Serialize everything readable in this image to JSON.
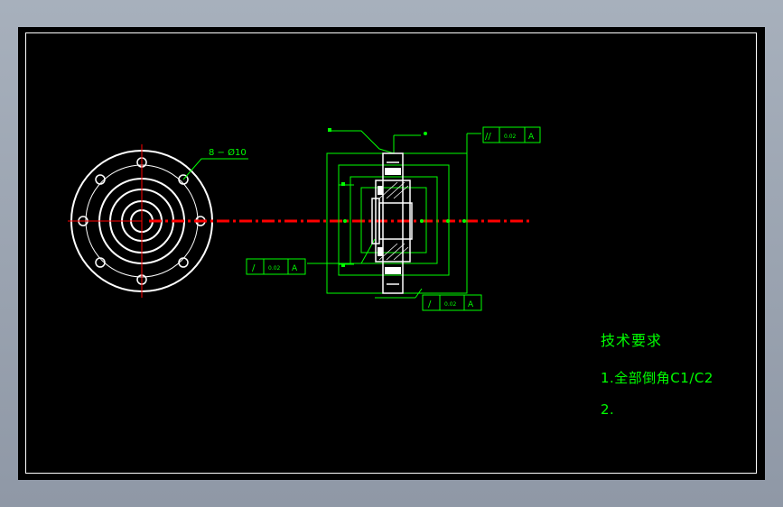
{
  "colors": {
    "background": "#000000",
    "frame": "#ffffff",
    "geometry": "#ffffff",
    "dimensions": "#00ff00",
    "centerline": "#ff0000",
    "viewport": "#9aa3b0"
  },
  "drawing": {
    "bolt_label": "8 − Ø10",
    "tolerance_frames": [
      {
        "symbol": "//",
        "value": "0.02",
        "datum": "A"
      },
      {
        "symbol": "/",
        "value": "0.02",
        "datum": "A"
      },
      {
        "symbol": "/",
        "value": "0.02",
        "datum": "A"
      }
    ]
  },
  "notes": {
    "title": "技术要求",
    "items": [
      "1.全部倒角C1/C2",
      "2."
    ]
  }
}
